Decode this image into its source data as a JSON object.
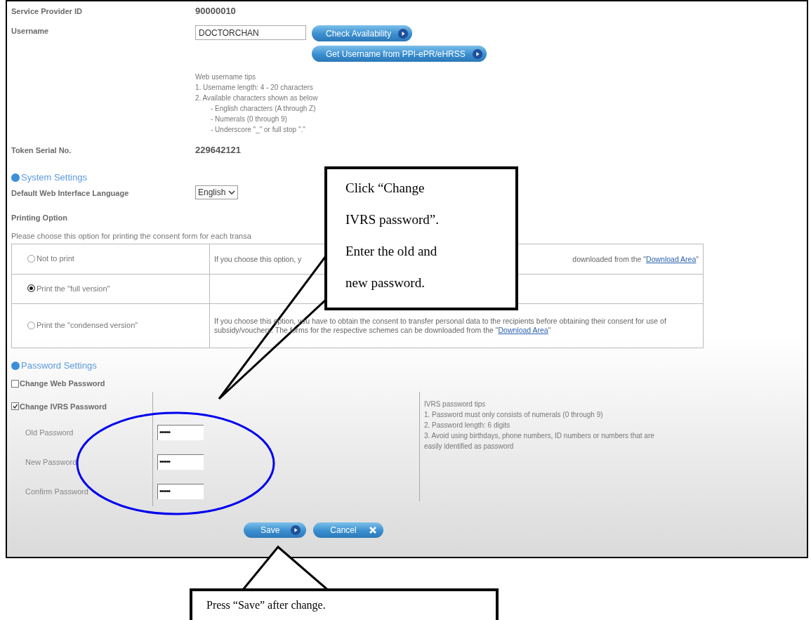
{
  "service_provider": {
    "label": "Service Provider ID",
    "value": "90000010"
  },
  "username": {
    "label": "Username",
    "value": "DOCTORCHAN",
    "buttons": [
      "Check Availability",
      "Get Username from PPI-ePR/eHRSS"
    ],
    "tips": {
      "title": "Web username tips",
      "items": [
        {
          "text": "1. Username length: 4 - 20 characters"
        },
        {
          "text": "2. Available characters shown as below",
          "children": [
            {
              "text": "- English characters (A through Z)"
            },
            {
              "text": "- Numerals (0 through 9)"
            },
            {
              "text": "- Underscore \"_\" or full stop \".\""
            }
          ]
        }
      ]
    }
  },
  "token": {
    "label": "Token Serial No.",
    "value": "229642121"
  },
  "system_settings": {
    "heading": "System Settings",
    "language": {
      "label": "Default Web Interface Language",
      "value": "English"
    },
    "printing": {
      "label": "Printing Option",
      "instruction": "Please choose this option for printing the consent form for each transa",
      "options": [
        {
          "label": "Not to print",
          "selected": false,
          "description": {
            "lead": "If you choose this option, y",
            "text": "downloaded from the \"",
            "link": "Download Area",
            "after": "\""
          }
        },
        {
          "label": "Print the \"full version\"",
          "selected": true
        },
        {
          "label": "Print the \"condensed version\"",
          "selected": false,
          "description": {
            "text": "If you choose this option, you have to obtain the consent to transfer personal data to the recipients before obtaining their consent for use of subsidy/vouchers. The forms for the respective schemes can be downloaded from the \"",
            "link": "Download Area",
            "after": "\""
          }
        }
      ]
    }
  },
  "password_settings": {
    "heading": "Password Settings",
    "options": [
      {
        "label": "Change Web Password",
        "checked": false
      },
      {
        "label": "Change IVRS Password",
        "checked": true
      }
    ],
    "fields": [
      {
        "label": "Old Password",
        "value": "••••••"
      },
      {
        "label": "New Password",
        "value": "••••••"
      },
      {
        "label": "Confirm Password",
        "value": "••••••"
      }
    ],
    "tips": [
      "IVRS password tips",
      "1. Password must only consists of numerals (0 through 9)",
      "2. Password length: 6 digits",
      "3. Avoid using birthdays, phone numbers, ID numbers or numbers that are easily identified as password"
    ]
  },
  "buttons": [
    {
      "label": "Save",
      "kind": "next"
    },
    {
      "label": "Cancel",
      "kind": "cancel"
    }
  ],
  "annotations": [
    {
      "text": "Click “Change IVRS password”. Enter the old and new password."
    },
    {
      "text": "Press “Save” after change."
    }
  ]
}
